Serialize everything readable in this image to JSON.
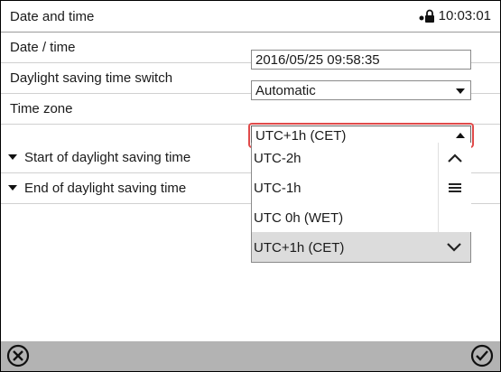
{
  "header": {
    "title": "Date and time",
    "time": "10:03:01",
    "lock_icon": "lock-icon"
  },
  "rows": [
    {
      "label": "Date / time",
      "value": "2016/05/25 09:58:35"
    },
    {
      "label": "Daylight saving time switch",
      "value": "Automatic"
    },
    {
      "label": "Time zone",
      "value": "UTC+1h (CET)"
    },
    {
      "label": "Start of daylight saving time"
    },
    {
      "label": "End of daylight saving time"
    }
  ],
  "timezone_options": [
    "UTC-2h",
    "UTC-1h",
    "UTC 0h (WET)",
    "UTC+1h (CET)"
  ],
  "footer": {
    "cancel_icon": "cancel-icon",
    "confirm_icon": "confirm-icon"
  },
  "colors": {
    "highlight": "#e04a4a",
    "footer": "#b3b3b3",
    "selected_option": "#dcdcdc"
  }
}
